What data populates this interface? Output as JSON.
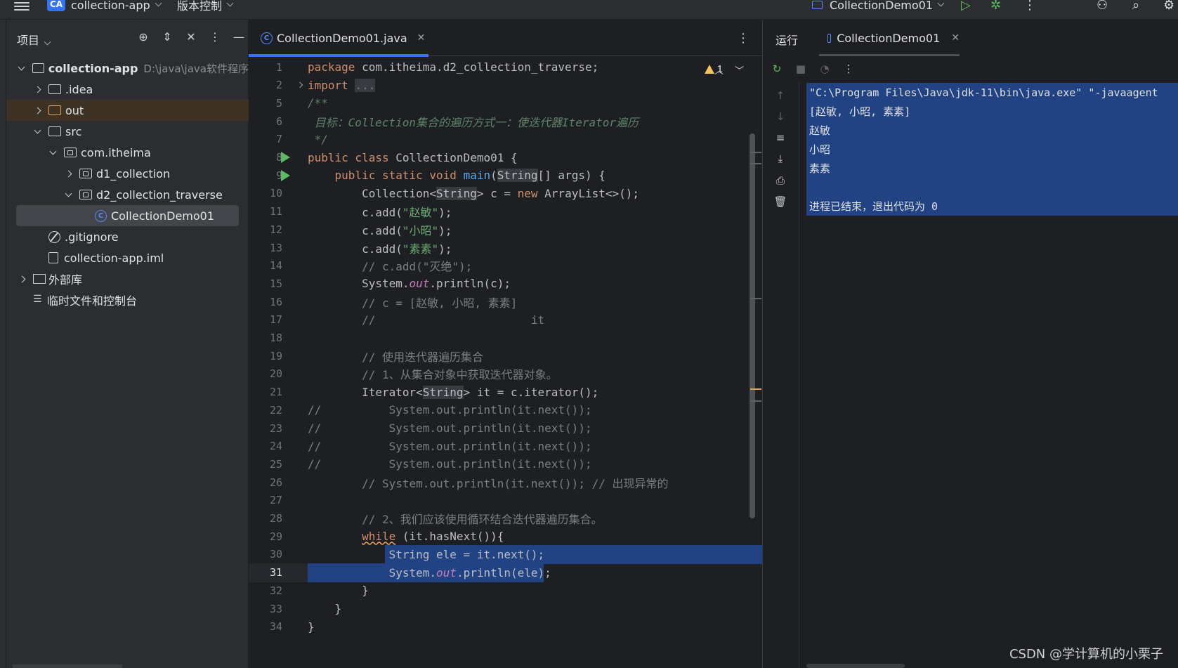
{
  "topbar": {
    "project_badge": "CA",
    "project_name": "collection-app",
    "vcs_menu": "版本控制",
    "run_config": "CollectionDemo01"
  },
  "project_panel": {
    "title": "项目",
    "tree": [
      {
        "label": "collection-app",
        "hint": "D:\\java\\java软件程序",
        "level": 0,
        "expand": "down",
        "icon": "module-folder-icon"
      },
      {
        "label": ".idea",
        "level": 1,
        "expand": "right",
        "icon": "folder-icon"
      },
      {
        "label": "out",
        "level": 1,
        "expand": "right",
        "icon": "folder-excluded-icon"
      },
      {
        "label": "src",
        "level": 1,
        "expand": "down",
        "icon": "source-folder-icon"
      },
      {
        "label": "com.itheima",
        "level": 2,
        "expand": "down",
        "icon": "package-icon"
      },
      {
        "label": "d1_collection",
        "level": 3,
        "expand": "right",
        "icon": "package-icon"
      },
      {
        "label": "d2_collection_traverse",
        "level": 3,
        "expand": "down",
        "icon": "package-icon"
      },
      {
        "label": "CollectionDemo01",
        "level": 4,
        "expand": "none",
        "icon": "java-class-icon"
      },
      {
        "label": ".gitignore",
        "level": 1,
        "expand": "none",
        "icon": "ignore-file-icon"
      },
      {
        "label": "collection-app.iml",
        "level": 1,
        "expand": "none",
        "icon": "iml-file-icon"
      },
      {
        "label": "外部库",
        "level": 0,
        "expand": "right",
        "icon": "library-icon"
      },
      {
        "label": "临时文件和控制台",
        "level": 0,
        "expand": "none",
        "icon": "scratches-icon"
      }
    ]
  },
  "editor": {
    "tab_label": "CollectionDemo01.java",
    "warning_count": "1",
    "lines": [
      {
        "n": "1",
        "html": "<span class='kw'>package</span> com.itheima.d2_collection_traverse;"
      },
      {
        "n": "2",
        "html": "<span class='kw'>import</span> <span class='dots'>...</span>"
      },
      {
        "n": "5",
        "html": "<span class='cm-doc'>/**</span>"
      },
      {
        "n": "6",
        "html": "<span class='cm-doc'> 目标：Collection集合的遍历方式一：使迭代器Iterator遍历</span>"
      },
      {
        "n": "7",
        "html": "<span class='cm-doc'> */</span>"
      },
      {
        "n": "8",
        "html": "<span class='kw'>public class</span> CollectionDemo01 {"
      },
      {
        "n": "9",
        "html": "    <span class='kw'>public static void</span> <span class='fn'>main</span>(<span class='ty-hl'>String</span>[] args) {"
      },
      {
        "n": "10",
        "html": "        Collection&lt;<span class='ty-hl'>String</span>&gt; c = <span class='kw'>new</span> ArrayList&lt;&gt;();"
      },
      {
        "n": "11",
        "html": "        c.add(<span class='str'>\"赵敏\"</span>);"
      },
      {
        "n": "12",
        "html": "        c.add(<span class='str'>\"小昭\"</span>);"
      },
      {
        "n": "13",
        "html": "        c.add(<span class='str'>\"素素\"</span>);"
      },
      {
        "n": "14",
        "html": "        <span class='cm'>// c.add(\"灭绝\");</span>"
      },
      {
        "n": "15",
        "html": "        System.<span class='st'>out</span>.println(c);"
      },
      {
        "n": "16",
        "html": "        <span class='cm'>// c = [赵敏, 小昭, 素素]</span>"
      },
      {
        "n": "17",
        "html": "        <span class='cm'>//                       it</span>"
      },
      {
        "n": "18",
        "html": ""
      },
      {
        "n": "19",
        "html": "        <span class='cm'>// 使用迭代器遍历集合</span>"
      },
      {
        "n": "20",
        "html": "        <span class='cm'>// 1、从集合对象中获取迭代器对象。</span>"
      },
      {
        "n": "21",
        "html": "        Iterator&lt;<span class='ty-hl'>String</span>&gt; it = c.iterator();"
      },
      {
        "n": "22",
        "html": "<span class='cm'>//          System.out.println(it.next());</span>"
      },
      {
        "n": "23",
        "html": "<span class='cm'>//          System.out.println(it.next());</span>"
      },
      {
        "n": "24",
        "html": "<span class='cm'>//          System.out.println(it.next());</span>"
      },
      {
        "n": "25",
        "html": "<span class='cm'>//          System.out.println(it.next());</span>"
      },
      {
        "n": "26",
        "html": "        <span class='cm'>// System.out.println(it.next()); // 出现异常的</span>"
      },
      {
        "n": "27",
        "html": ""
      },
      {
        "n": "28",
        "html": "        <span class='cm'>// 2、我们应该使用循环结合迭代器遍历集合。</span>"
      },
      {
        "n": "29",
        "html": "        <span class='kw' style='text-decoration:underline wavy #e5a35a'>while</span> (it.hasNext()){"
      },
      {
        "n": "30",
        "html": "            String ele = it.next();"
      },
      {
        "n": "31",
        "html": "            System.<span class='st'>out</span>.println(ele);"
      },
      {
        "n": "32",
        "html": "        }"
      },
      {
        "n": "33",
        "html": "    }"
      },
      {
        "n": "34",
        "html": "}"
      }
    ]
  },
  "run_panel": {
    "title": "运行",
    "tab_label": "CollectionDemo01",
    "console": [
      "\"C:\\Program Files\\Java\\jdk-11\\bin\\java.exe\" \"-javaagent",
      "[赵敏, 小昭, 素素]",
      "赵敏",
      "小昭",
      "素素",
      "",
      "进程已结束，退出代码为 0"
    ]
  },
  "watermark": "CSDN @学计算机的小栗子",
  "colors": {
    "accent": "#3574f0",
    "selection": "#214283",
    "keyword": "#cf8e6d",
    "string": "#6aab73",
    "comment": "#7a7e85",
    "run_green": "#5fb865"
  }
}
